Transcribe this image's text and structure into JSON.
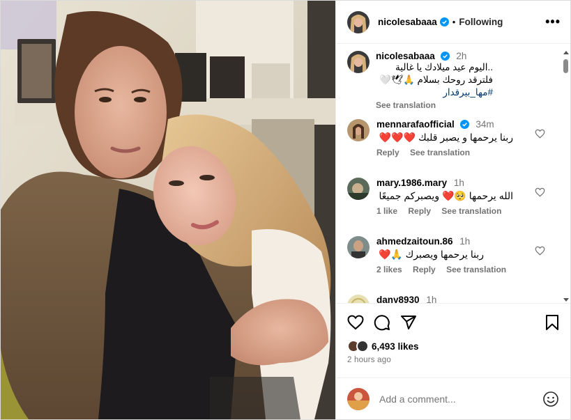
{
  "post": {
    "username": "nicolesabaaa",
    "follow_status": "Following",
    "more": "•••"
  },
  "caption": {
    "username": "nicolesabaaa",
    "time": "2h",
    "line1": "..اليوم عيد ميلادك يا غالية",
    "line2": "فلترقد روحك بسلام 🙏🕊🤍",
    "hashtag": "#مها_بيرقدار",
    "see_translation": "See translation"
  },
  "comments": [
    {
      "username": "mennarafaofficial",
      "verified": true,
      "time": "34m",
      "text": "ربنا يرحمها و يصبر قلبك ❤️❤️❤️",
      "likes": "",
      "reply": "Reply",
      "see_translation": "See translation"
    },
    {
      "username": "mary.1986.mary",
      "verified": false,
      "time": "1h",
      "text": "الله يرحمها 🥺❤️ ويصبركم جميعًا",
      "likes": "1 like",
      "reply": "Reply",
      "see_translation": "See translation"
    },
    {
      "username": "ahmedzaitoun.86",
      "verified": false,
      "time": "1h",
      "text": "ربنا يرحمها ويصبرك 🙏❤️",
      "likes": "2 likes",
      "reply": "Reply",
      "see_translation": "See translation"
    },
    {
      "username": "dany8930",
      "verified": false,
      "time": "1h"
    }
  ],
  "footer": {
    "likes": "6,493 likes",
    "time_ago": "2 hours ago",
    "add_comment_placeholder": "Add a comment..."
  },
  "icons": {
    "like": "heart-icon",
    "comment": "comment-icon",
    "share": "share-icon",
    "save": "bookmark-icon",
    "emoji": "emoji-icon",
    "verified": "verified-badge-icon"
  },
  "colors": {
    "verified": "#0095f6",
    "red_heart": "#e0245e",
    "muted": "#737373",
    "hashtag": "#00376b"
  }
}
